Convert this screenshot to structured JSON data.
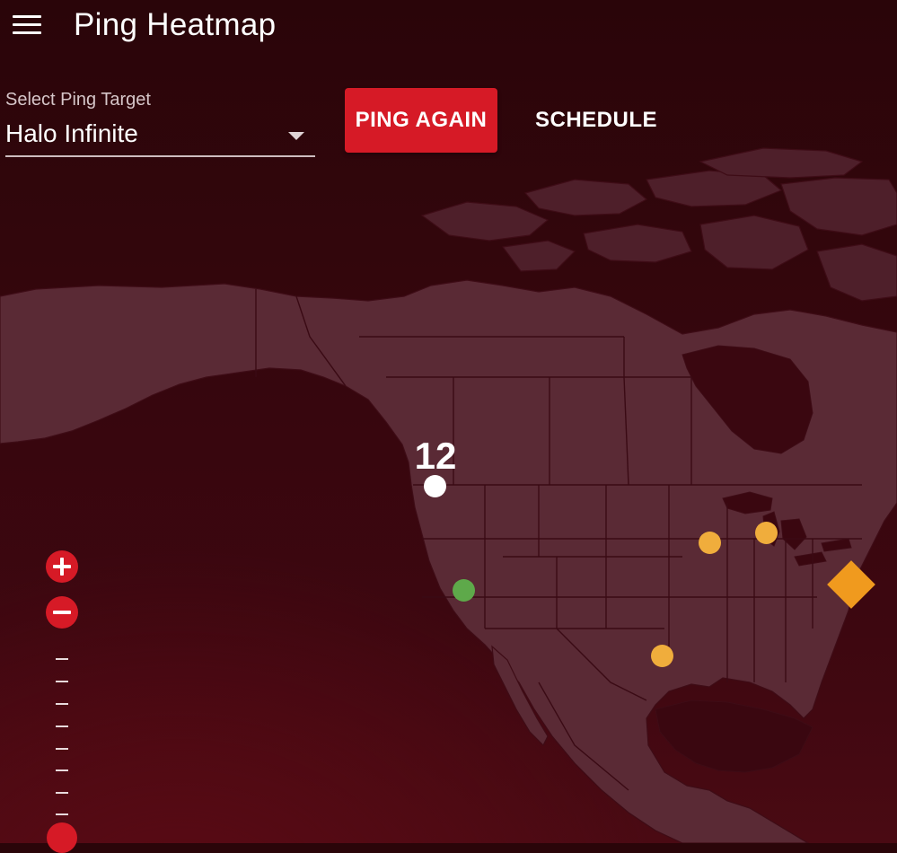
{
  "app": {
    "title": "Ping Heatmap"
  },
  "controls": {
    "select_label": "Select Ping Target",
    "select_value": "Halo Infinite",
    "ping_again_label": "PING AGAIN",
    "schedule_label": "SCHEDULE"
  },
  "map": {
    "cluster_count": "12",
    "markers": [
      {
        "name": "cluster-marker-west",
        "color": "#ffffff"
      },
      {
        "name": "ping-marker-california",
        "color": "#5ea94a"
      },
      {
        "name": "ping-marker-iowa",
        "color": "#f0ad3c"
      },
      {
        "name": "ping-marker-michigan",
        "color": "#f0ad3c"
      },
      {
        "name": "ping-marker-texas",
        "color": "#f0ad3c"
      },
      {
        "name": "ping-marker-virginia-diamond",
        "color": "#f09a1e"
      }
    ]
  },
  "zoom": {
    "zoom_in_icon": "plus-icon",
    "zoom_out_icon": "minus-icon",
    "tick_count": 8,
    "level": 0
  },
  "colors": {
    "accent": "#d61a26",
    "background": "#35060d",
    "land": "#5a2a35"
  }
}
